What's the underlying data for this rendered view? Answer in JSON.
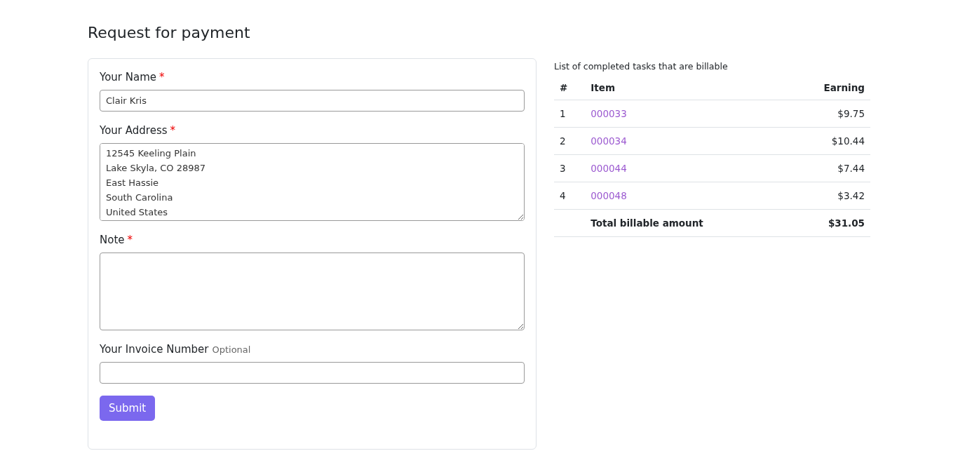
{
  "title": "Request for payment",
  "form": {
    "fields": [
      {
        "label": "Your Name",
        "required_mark": "*",
        "kind": "input",
        "value": "Clair Kris"
      },
      {
        "label": "Your Address",
        "required_mark": "*",
        "kind": "textarea",
        "value": [
          "12545 Keeling Plain",
          "Lake Skyla, CO 28987",
          "East Hassie",
          "South Carolina",
          "United States"
        ]
      },
      {
        "label": "Note",
        "required_mark": "*",
        "kind": "textarea"
      },
      {
        "label": "Your Invoice Number",
        "hint": "Optional",
        "kind": "input"
      }
    ],
    "submit": "Submit"
  },
  "table": {
    "caption": "List of completed tasks that are billable",
    "columns": [
      "#",
      "Item",
      "Earning"
    ],
    "rows": [
      {
        "num": "1",
        "item": "000033",
        "earning": "$9.75"
      },
      {
        "num": "2",
        "item": "000034",
        "earning": "$10.44"
      },
      {
        "num": "3",
        "item": "000044",
        "earning": "$7.44"
      },
      {
        "num": "4",
        "item": "000048",
        "earning": "$3.42"
      }
    ],
    "total": {
      "label": "Total billable amount",
      "amount": "$31.05"
    }
  }
}
